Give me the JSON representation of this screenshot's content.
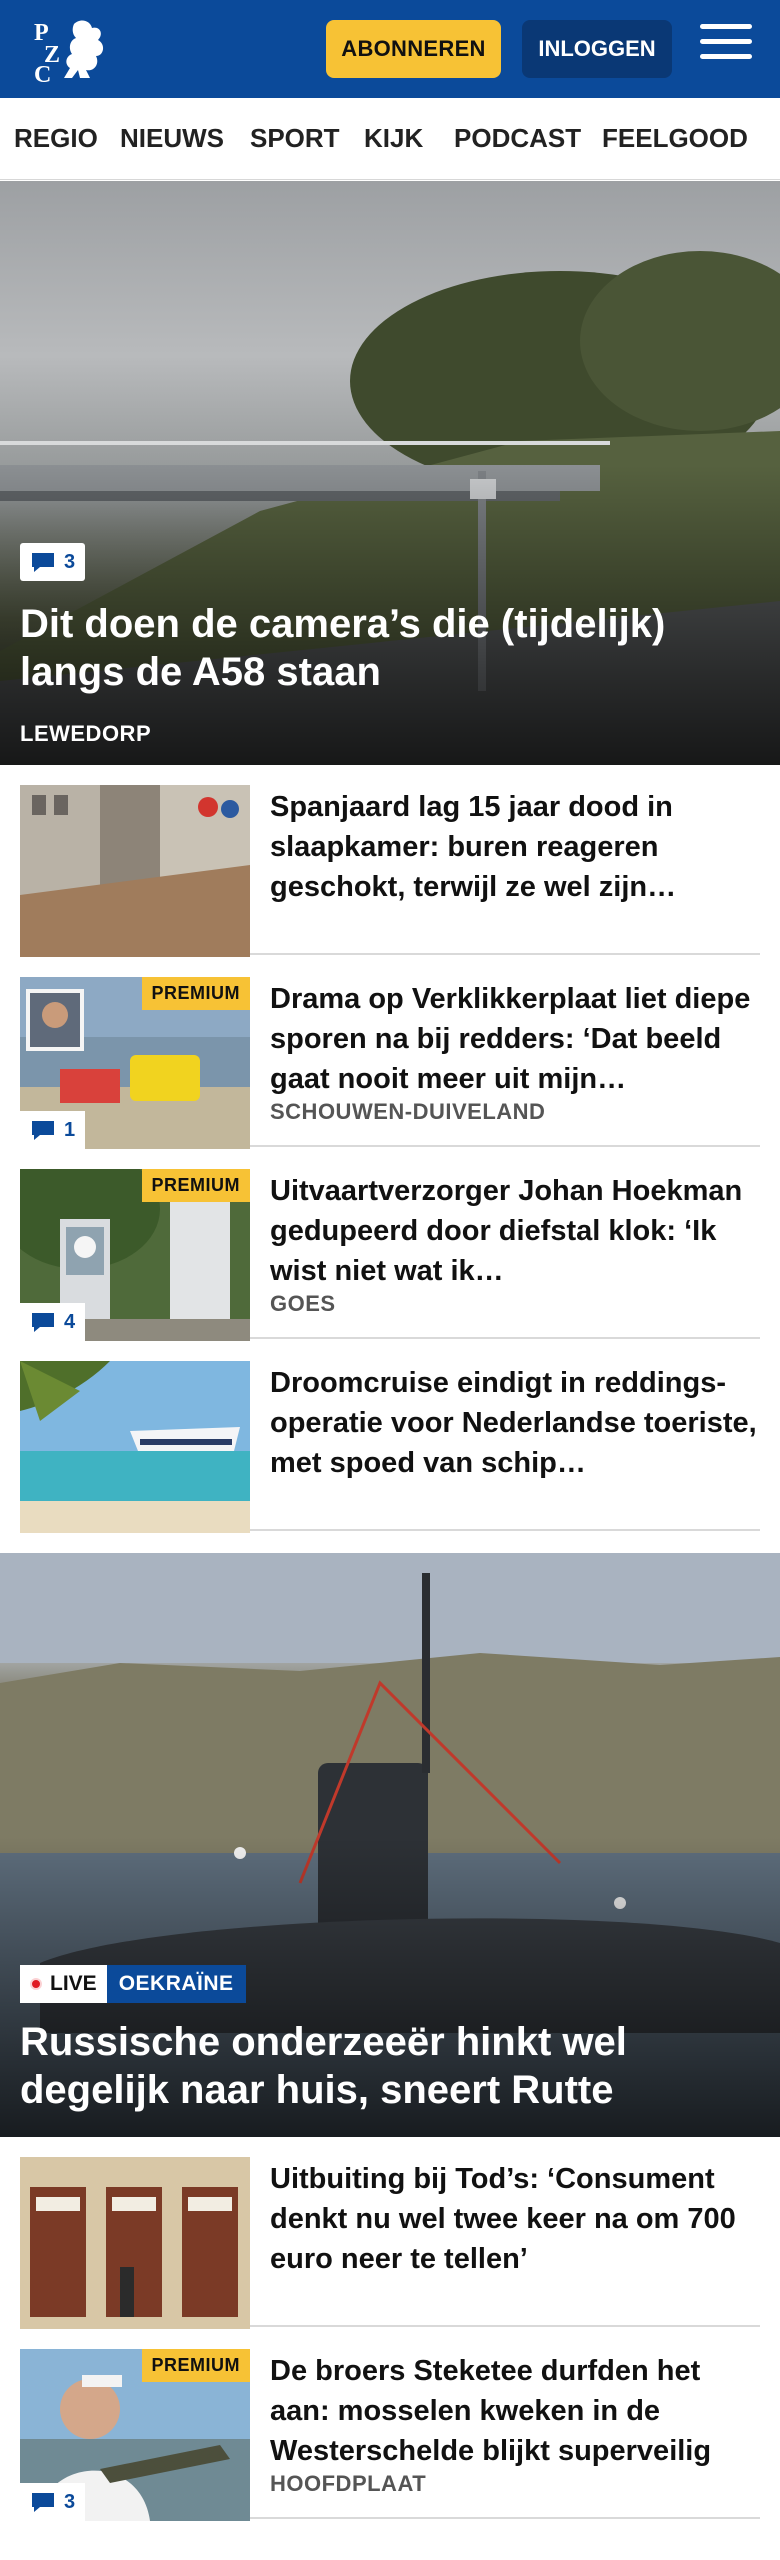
{
  "brand": {
    "logo_letters": [
      "P",
      "Z",
      "C"
    ],
    "colors": {
      "primary": "#0b4a9a",
      "accent": "#f7c235",
      "live": "#e01a22"
    }
  },
  "header": {
    "subscribe_label": "ABONNEREN",
    "login_label": "INLOGGEN",
    "menu_icon": "hamburger-menu-icon"
  },
  "nav": {
    "items": [
      "REGIO",
      "NIEUWS",
      "SPORT",
      "KIJK",
      "PODCAST",
      "FEELGOOD"
    ]
  },
  "hero_top": {
    "comments": "3",
    "title": "Dit doen de camera’s die (tijdelijk) langs de A58 staan",
    "location": "LEWEDORP"
  },
  "articles_1": [
    {
      "title": "Spanjaard lag 15 jaar dood in slaapkamer: buren reageren geschokt, terwijl ze wel zijn…",
      "premium": false,
      "comments": "",
      "location": ""
    },
    {
      "title": "Drama op Verklikkerplaat liet diepe sporen na bij redders: ‘Dat beeld gaat nooit meer uit mijn…",
      "premium": true,
      "comments": "1",
      "location": "SCHOUWEN-DUIVELAND"
    },
    {
      "title": "Uitvaartverzorger Johan Hoekman gedupeerd door diefstal klok: ‘Ik wist niet wat ik…",
      "premium": true,
      "comments": "4",
      "location": "GOES"
    },
    {
      "title": "Droomcruise eindigt in reddings­operatie voor Nederlandse toeriste, met spoed van schip…",
      "premium": false,
      "comments": "",
      "location": ""
    }
  ],
  "premium_label": "PREMIUM",
  "hero_live": {
    "live_label": "LIVE",
    "tag": "OEKRAÏNE",
    "title": "Russische onderzeeër hinkt wel degelijk naar huis, sneert Rutte"
  },
  "articles_2": [
    {
      "title": "Uitbuiting bij Tod’s: ‘Consument denkt nu wel twee keer na om 700 euro neer te tellen’",
      "premium": false,
      "comments": "",
      "location": ""
    },
    {
      "title": "De broers Steketee durfden het aan: mosselen kweken in de Westerschelde blijkt superveilig",
      "premium": true,
      "comments": "3",
      "location": "HOOFDPLAAT"
    }
  ],
  "icons": {
    "comment": "speech-bubble-icon",
    "live": "live-dot-icon"
  }
}
